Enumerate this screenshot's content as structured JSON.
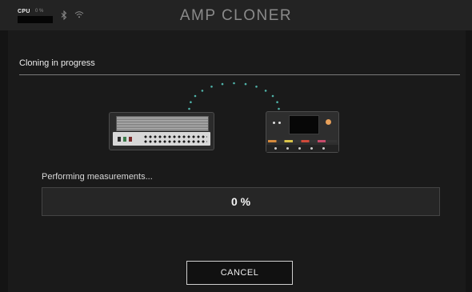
{
  "header": {
    "cpu_label": "CPU",
    "cpu_percent": "0 %",
    "cpu_meter_fraction": 0,
    "app_title": "AMP CLONER",
    "icons": [
      "bluetooth-icon",
      "wifi-icon"
    ]
  },
  "main": {
    "section_title": "Cloning in progress",
    "status_text": "Performing measurements...",
    "progress": {
      "value": 0,
      "label": "0 %"
    },
    "cancel_label": "CANCEL"
  },
  "colors": {
    "background": "#141414",
    "accent_teal": "#4fb3a9",
    "topbar": "#232323"
  }
}
